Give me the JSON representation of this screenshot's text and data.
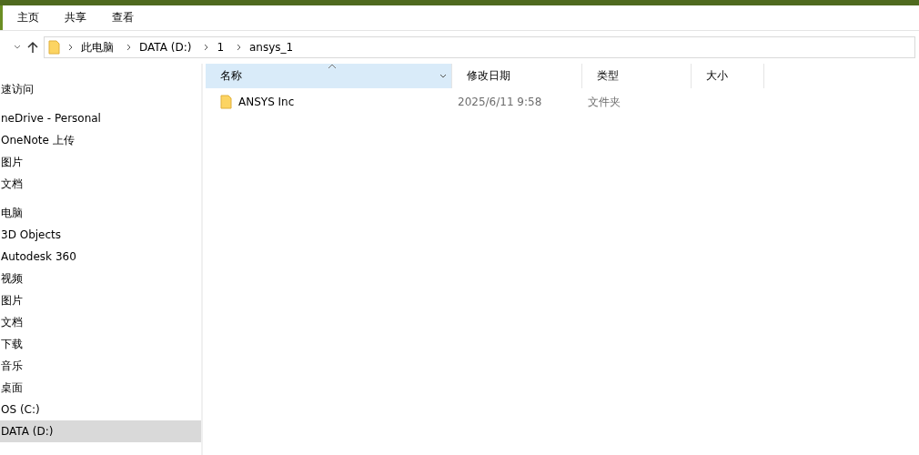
{
  "ribbon": {
    "tabs": [
      {
        "label": "主页",
        "selected": false
      },
      {
        "label": "共享",
        "selected": false
      },
      {
        "label": "查看",
        "selected": false
      }
    ]
  },
  "address_bar": {
    "crumbs": [
      "此电脑",
      "DATA (D:)",
      "1",
      "ansys_1"
    ]
  },
  "sidebar": {
    "groups": [
      [
        {
          "label": "速访问",
          "selected": false
        }
      ],
      [
        {
          "label": "neDrive - Personal",
          "selected": false
        },
        {
          "label": "OneNote 上传",
          "selected": false
        },
        {
          "label": "图片",
          "selected": false
        },
        {
          "label": "文档",
          "selected": false
        }
      ],
      [
        {
          "label": "电脑",
          "selected": false
        },
        {
          "label": "3D Objects",
          "selected": false
        },
        {
          "label": "Autodesk 360",
          "selected": false
        },
        {
          "label": "视频",
          "selected": false
        },
        {
          "label": "图片",
          "selected": false
        },
        {
          "label": "文档",
          "selected": false
        },
        {
          "label": "下载",
          "selected": false
        },
        {
          "label": "音乐",
          "selected": false
        },
        {
          "label": "桌面",
          "selected": false
        },
        {
          "label": "OS (C:)",
          "selected": false
        },
        {
          "label": "DATA (D:)",
          "selected": true
        }
      ]
    ]
  },
  "table": {
    "columns": [
      {
        "label": "名称",
        "sorted": true
      },
      {
        "label": "修改日期",
        "sorted": false
      },
      {
        "label": "类型",
        "sorted": false
      },
      {
        "label": "大小",
        "sorted": false
      }
    ],
    "rows": [
      {
        "name": "ANSYS Inc",
        "date": "2025/6/11 9:58",
        "type": "文件夹"
      }
    ]
  }
}
